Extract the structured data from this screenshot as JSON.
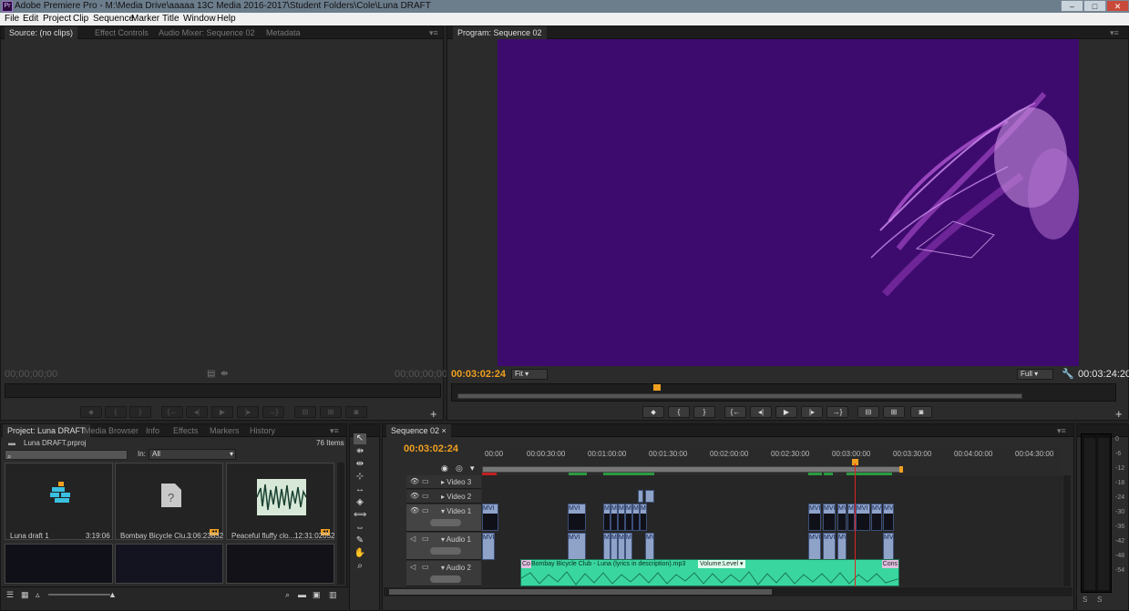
{
  "window": {
    "title": "Adobe Premiere Pro - M:\\Media Drive\\aaaaa 13C Media 2016-2017\\Student Folders\\Cole\\Luna DRAFT"
  },
  "menu": [
    "File",
    "Edit",
    "Project",
    "Clip",
    "Sequence",
    "Marker",
    "Title",
    "Window",
    "Help"
  ],
  "source_panel": {
    "tabs": [
      "Source: (no clips)",
      "Effect Controls",
      "Audio Mixer: Sequence 02",
      "Metadata"
    ],
    "timecode_left": "00;00;00;00",
    "timecode_right": "00;00;00;00"
  },
  "program_panel": {
    "tab": "Program: Sequence 02",
    "timecode_current": "00:03:02:24",
    "timecode_duration": "00:03:24:20",
    "fit": "Fit",
    "quality": "Full",
    "playhead_fraction": 0.885
  },
  "project_panel": {
    "tabs": [
      "Project: Luna DRAFT",
      "Media Browser",
      "Info",
      "Effects",
      "Markers",
      "History"
    ],
    "file": "Luna DRAFT.prproj",
    "item_count": "76 Items",
    "in_label": "In:",
    "in_value": "All",
    "items": [
      {
        "name": "Luna draft 1",
        "duration": "3:19:06"
      },
      {
        "name": "Bombay Bicycle Clu...",
        "duration": "3:06:23832"
      },
      {
        "name": "Peaceful fluffy clo...",
        "duration": "12:31:02052"
      }
    ]
  },
  "timeline": {
    "tab": "Sequence 02",
    "timecode": "00:03:02:24",
    "ruler": [
      "00:00",
      "00:00:30:00",
      "00:01:00:00",
      "00:01:30:00",
      "00:02:00:00",
      "00:02:30:00",
      "00:03:00:00",
      "00:03:30:00",
      "00:04:00:00",
      "00:04:30:00"
    ],
    "tracks": [
      "Video 3",
      "Video 2",
      "Video 1",
      "Audio 1",
      "Audio 2"
    ],
    "clip_label": "MVI",
    "audio_clip_label": "Bombay Bicycle Club - Luna (lyrics in description).mp3",
    "audio_clip_prefix": "Co",
    "volume_label": "Volume:Level",
    "audio_clip_end": "Cons"
  },
  "audio_meter": {
    "scale": [
      "0",
      "-6",
      "-12",
      "-18",
      "-24",
      "-30",
      "-36",
      "-42",
      "-48",
      "-54"
    ],
    "s_labels": [
      "S",
      "S"
    ]
  },
  "colors": {
    "timecode": "#f0a020",
    "program_bg": "#3d0b6e",
    "audio_clip": "#3ad6a0",
    "video_clip": "#8fa3c8",
    "playhead": "#d22"
  },
  "icons": [
    "app-icon",
    "minimize-icon",
    "maximize-icon",
    "close-icon",
    "search-icon",
    "select-tool-icon",
    "track-select-icon",
    "ripple-edit-icon",
    "rolling-edit-icon",
    "rate-stretch-icon",
    "razor-icon",
    "slip-icon",
    "slide-icon",
    "pen-icon",
    "hand-icon",
    "zoom-icon",
    "eye-icon",
    "speaker-icon",
    "marker-icon",
    "play-icon",
    "camera-icon"
  ]
}
